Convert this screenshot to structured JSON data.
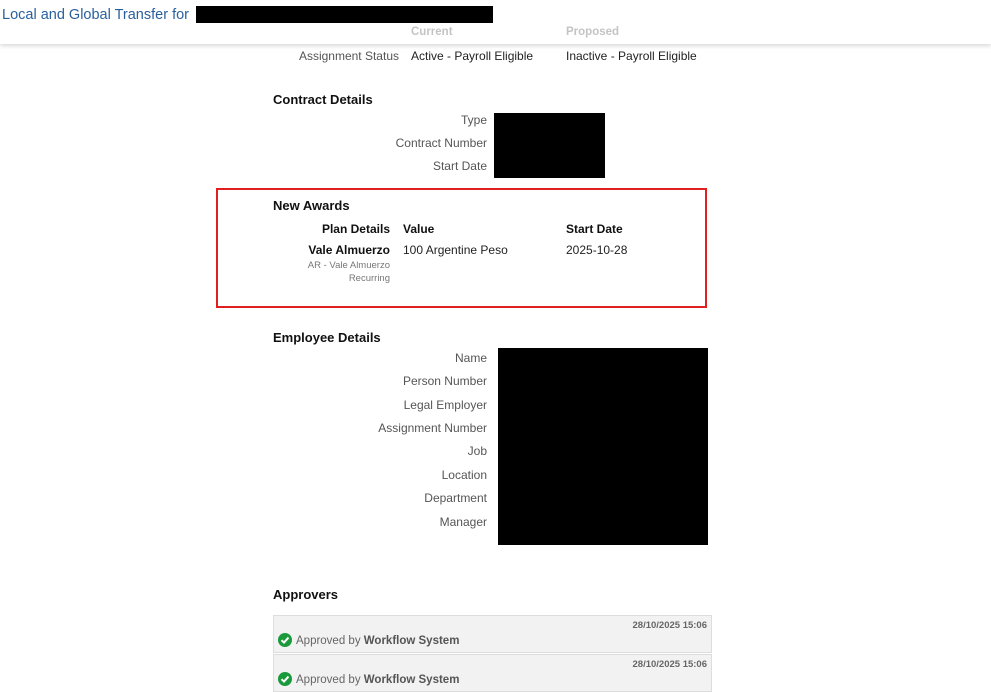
{
  "header": {
    "title": "Local and Global Transfer for"
  },
  "assignment": {
    "col_current": "Current",
    "col_proposed": "Proposed",
    "label": "Assignment Status",
    "current": "Active - Payroll Eligible",
    "proposed": "Inactive - Payroll Eligible"
  },
  "contract": {
    "heading": "Contract Details",
    "labels": [
      "Type",
      "Contract Number",
      "Start Date"
    ]
  },
  "awards": {
    "heading": "New Awards",
    "col_plan": "Plan Details",
    "col_value": "Value",
    "col_start": "Start Date",
    "plan_name": "Vale Almuerzo",
    "plan_sub1": "AR - Vale Almuerzo",
    "plan_sub2": "Recurring",
    "value": "100 Argentine Peso",
    "start": "2025-10-28",
    "highlight_color": "#e02020"
  },
  "employee": {
    "heading": "Employee Details",
    "labels": [
      "Name",
      "Person Number",
      "Legal Employer",
      "Assignment Number",
      "Job",
      "Location",
      "Department",
      "Manager"
    ]
  },
  "approvers": {
    "heading": "Approvers",
    "items": [
      {
        "timestamp": "28/10/2025 15:06",
        "prefix": "Approved by",
        "who": "Workflow System"
      },
      {
        "timestamp": "28/10/2025 15:06",
        "prefix": "Approved by",
        "who": "Workflow System"
      }
    ]
  }
}
